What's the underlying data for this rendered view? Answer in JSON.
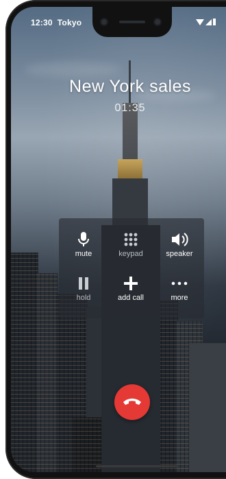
{
  "status_bar": {
    "time": "12:30",
    "location": "Tokyo"
  },
  "call": {
    "caller_name": "New York sales",
    "duration": "01:35"
  },
  "controls": [
    {
      "label": "mute",
      "icon": "microphone-icon",
      "dim": false
    },
    {
      "label": "keypad",
      "icon": "keypad-grid-icon",
      "dim": true
    },
    {
      "label": "speaker",
      "icon": "speaker-icon",
      "dim": false
    },
    {
      "label": "hold",
      "icon": "pause-icon",
      "dim": true
    },
    {
      "label": "add call",
      "icon": "plus-icon",
      "dim": false
    },
    {
      "label": "more",
      "icon": "ellipsis-icon",
      "dim": false
    }
  ],
  "end_call": {
    "icon": "hang-up-icon",
    "color": "#e53935"
  }
}
